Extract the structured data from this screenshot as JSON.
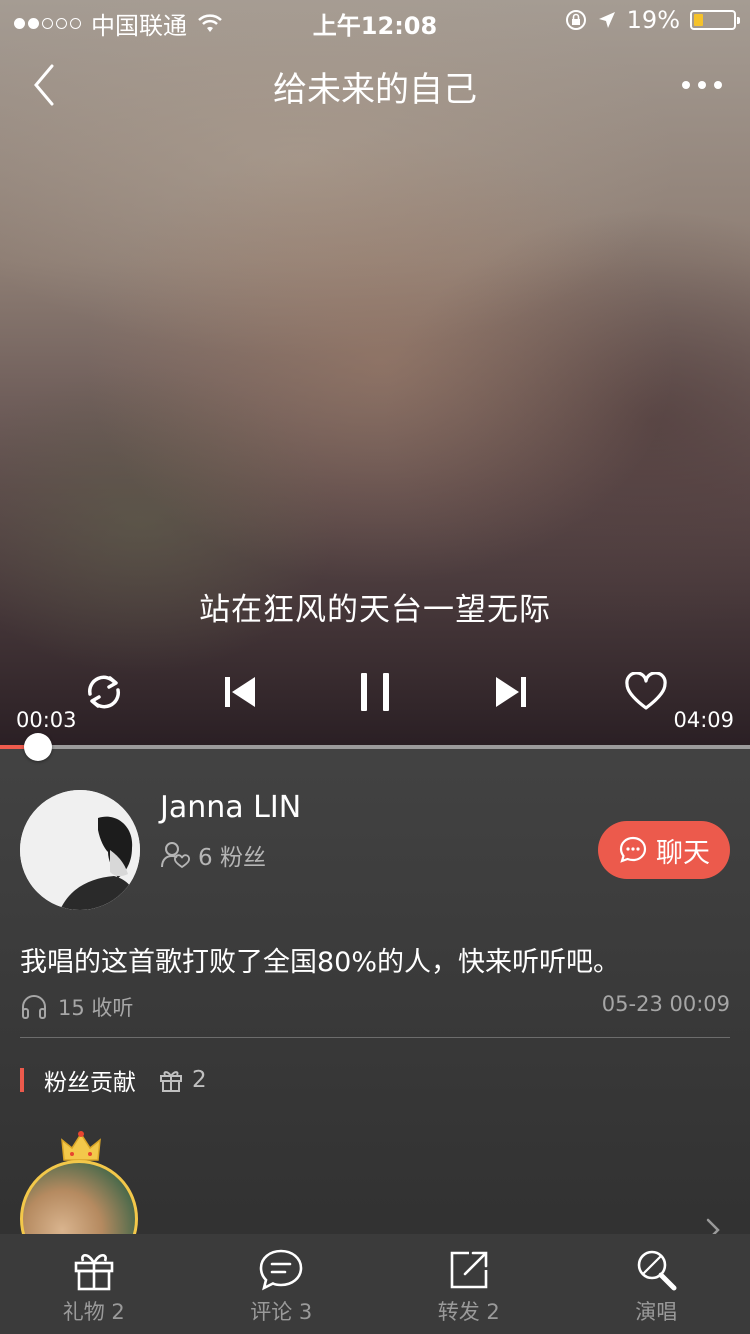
{
  "status_bar": {
    "carrier": "中国联通",
    "time": "上午12:08",
    "battery": "19%",
    "battery_level": 0.19
  },
  "nav": {
    "title": "给未来的自己"
  },
  "player": {
    "lyric": "站在狂风的天台一望无际",
    "current_time": "00:03",
    "total_time": "04:09",
    "progress": 0.012,
    "icons": [
      "loop-icon",
      "previous-icon",
      "pause-icon",
      "next-icon",
      "heart-icon"
    ]
  },
  "profile": {
    "name": "Janna LIN",
    "fans": "6 粉丝",
    "chat_label": "聊天",
    "description": "我唱的这首歌打败了全国80%的人，快来听听吧。",
    "listens": "15 收听",
    "date": "05-23 00:09"
  },
  "fan_section": {
    "title": "粉丝贡献",
    "gift_count": "2"
  },
  "tabbar": {
    "items": [
      {
        "label": "礼物 2",
        "icon": "gift-icon"
      },
      {
        "label": "评论 3",
        "icon": "comment-icon"
      },
      {
        "label": "转发 2",
        "icon": "share-icon"
      },
      {
        "label": "演唱",
        "icon": "microphone-icon"
      }
    ]
  },
  "colors": {
    "accent": "#ec5a4c",
    "battery": "#f5c22b",
    "crown": "#f3c84a"
  }
}
